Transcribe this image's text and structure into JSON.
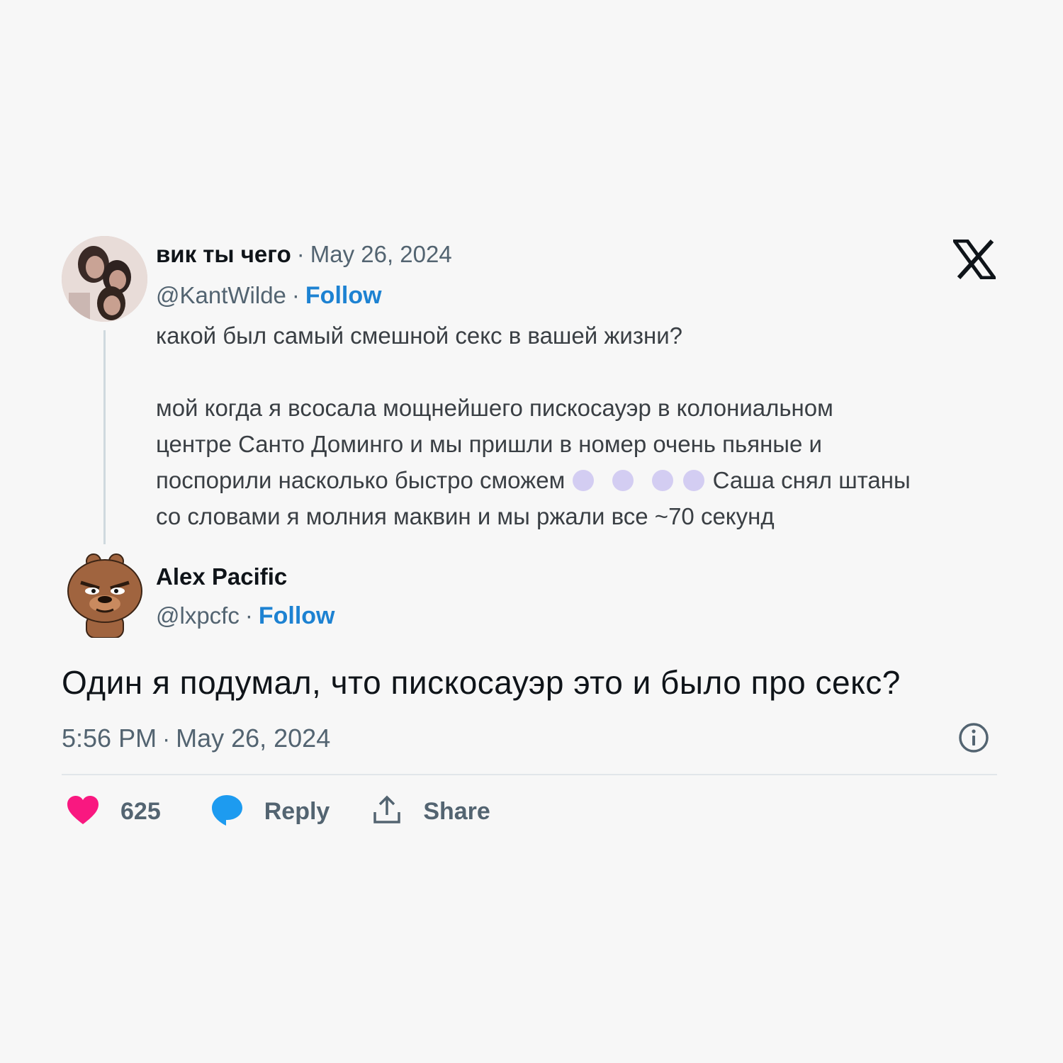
{
  "parent_tweet": {
    "display_name": "вик ты чего",
    "date": "May 26, 2024",
    "handle": "@KantWilde",
    "follow_label": "Follow",
    "text_line1": "какой был самый смешной секс в вашей жизни?",
    "text_line2": "мой когда я всосала мощнейшего пискосауэр в колониальном",
    "text_line3": "центре Санто Доминго и мы пришли в номер очень пьяные и",
    "text_line4a": "поспорили насколько быстро сможем",
    "text_line4b": "Саша снял штаны",
    "text_line5": "со словами я молния маквин и мы ржали все ~70 секунд"
  },
  "reply_tweet": {
    "display_name": "Alex Pacific",
    "handle": "@lxpcfc",
    "follow_label": "Follow",
    "text": "Один я подумал, что пискосауэр это и было про секс?",
    "time": "5:56 PM",
    "date": "May 26, 2024"
  },
  "actions": {
    "like_count": "625",
    "reply_label": "Reply",
    "share_label": "Share"
  },
  "separator": "·",
  "colors": {
    "background": "#f7f7f7",
    "follow": "#1d82d2",
    "like": "#f91880",
    "reply": "#1d9bf0",
    "secondary": "#536471",
    "spoiler": "#d3cdf2"
  },
  "icons": [
    "x-logo-icon",
    "info-icon",
    "heart-icon",
    "comment-bubble-icon",
    "share-icon"
  ]
}
